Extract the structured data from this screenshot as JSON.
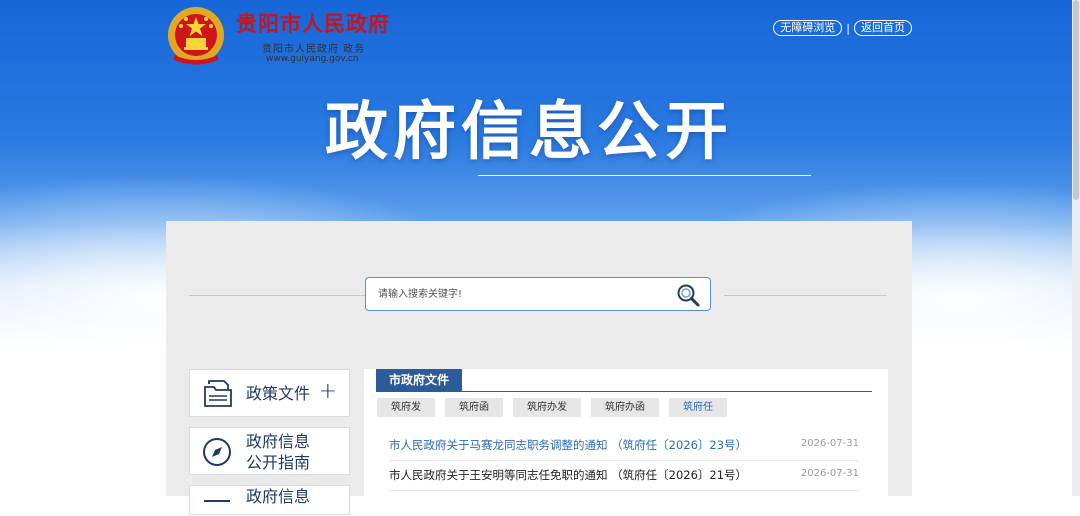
{
  "header": {
    "site_title": "贵阳市人民政府",
    "site_subtitle": "贵阳市人民政府 政务",
    "site_url": "www.guiyang.gov.cn",
    "accessibility_label": "无障碍浏览",
    "separator": "|",
    "home_label": "返回首页"
  },
  "hero": {
    "title": "政府信息公开"
  },
  "search": {
    "placeholder": "请输入搜索关键字!"
  },
  "sidebar": {
    "items": [
      {
        "label": "政策文件",
        "expand": "+"
      },
      {
        "label_line1": "政府信息",
        "label_line2": "公开指南"
      },
      {
        "label": "政府信息"
      }
    ]
  },
  "content": {
    "section_title": "市政府文件",
    "subtabs": [
      "筑府发",
      "筑府函",
      "筑府办发",
      "筑府办函",
      "筑府任"
    ],
    "active_subtab": "筑府任",
    "rows": [
      {
        "title": "市人民政府关于马赛龙同志职务调整的通知 （筑府任〔2026〕23号）",
        "date": "2026-07-31"
      },
      {
        "title": "市人民政府关于王安明等同志任免职的通知 （筑府任〔2026〕21号）",
        "date": "2026-07-31"
      }
    ]
  },
  "colors": {
    "brand_red": "#c6161d",
    "nav_blue": "#1e3a66",
    "tab_blue": "#2c5b9a",
    "link_blue": "#2a6bb9"
  }
}
